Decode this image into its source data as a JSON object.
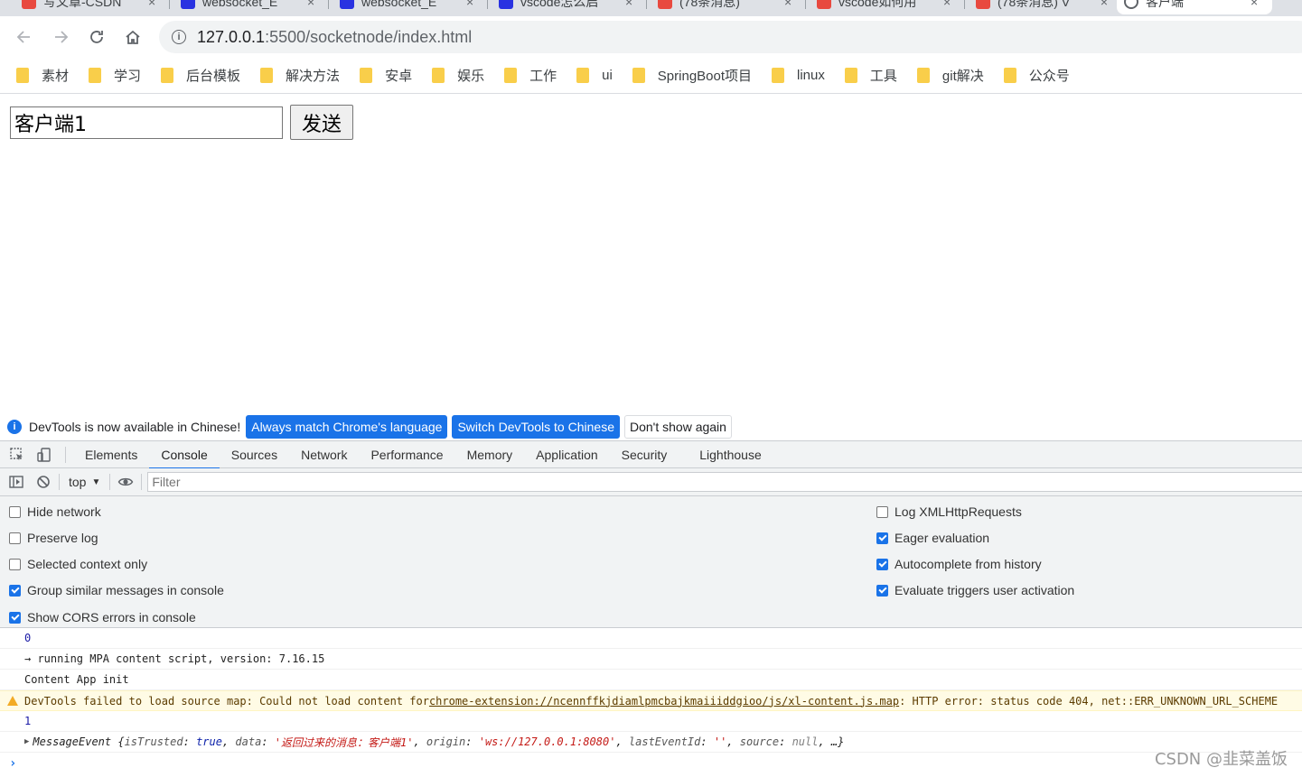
{
  "browser": {
    "tabs": [
      {
        "title": "写文章-CSDN",
        "color": "#e8493f"
      },
      {
        "title": "websocket_E",
        "color": "#2932e1"
      },
      {
        "title": "websocket_E",
        "color": "#2932e1"
      },
      {
        "title": "vscode怎么启",
        "color": "#2932e1"
      },
      {
        "title": "(78条消息)",
        "color": "#e8493f"
      },
      {
        "title": "vscode如何用",
        "color": "#e8493f"
      },
      {
        "title": "(78条消息) V",
        "color": "#e8493f"
      },
      {
        "title": "客户端",
        "color": "#5f6368"
      }
    ],
    "tab_close": "×",
    "url_host": "127.0.0.1",
    "url_path": ":5500/socketnode/index.html",
    "bookmarks": [
      "素材",
      "学习",
      "后台模板",
      "解决方法",
      "安卓",
      "娱乐",
      "工作",
      "ui",
      "SpringBoot项目",
      "linux",
      "工具",
      "git解决",
      "公众号"
    ]
  },
  "page": {
    "input_value": "客户端1",
    "send_label": "发送"
  },
  "devtools": {
    "infobar": {
      "text": "DevTools is now available in Chinese!",
      "btn_match": "Always match Chrome's language",
      "btn_switch": "Switch DevTools to Chinese",
      "btn_dismiss": "Don't show again"
    },
    "tabs": [
      "Elements",
      "Console",
      "Sources",
      "Network",
      "Performance",
      "Memory",
      "Application",
      "Security",
      "Lighthouse"
    ],
    "active_tab": "Console",
    "context": "top",
    "filter_placeholder": "Filter",
    "settings_left": [
      {
        "label": "Hide network",
        "checked": false
      },
      {
        "label": "Preserve log",
        "checked": false
      },
      {
        "label": "Selected context only",
        "checked": false
      },
      {
        "label": "Group similar messages in console",
        "checked": true
      },
      {
        "label": "Show CORS errors in console",
        "checked": true
      }
    ],
    "settings_right": [
      {
        "label": "Log XMLHttpRequests",
        "checked": false
      },
      {
        "label": "Eager evaluation",
        "checked": true
      },
      {
        "label": "Autocomplete from history",
        "checked": true
      },
      {
        "label": "Evaluate triggers user activation",
        "checked": true
      }
    ],
    "log": {
      "line1": "0",
      "line2": "→ running MPA content script, version: 7.16.15",
      "line3": "Content App init",
      "warn_prefix": "DevTools failed to load source map: Could not load content for ",
      "warn_link": "chrome-extension://ncennffkjdiamlpmcbajkmaiiiddgioo/js/xl-content.js.map",
      "warn_suffix": ": HTTP error: status code 404, net::ERR_UNKNOWN_URL_SCHEME",
      "line5": "1",
      "obj_name": "MessageEvent",
      "obj_istrusted_key": "isTrusted",
      "obj_istrusted_val": "true",
      "obj_data_key": "data",
      "obj_data_val": "'返回过来的消息：客户端1'",
      "obj_origin_key": "origin",
      "obj_origin_val": "'ws://127.0.0.1:8080'",
      "obj_lastid_key": "lastEventId",
      "obj_lastid_val": "''",
      "obj_source_key": "source",
      "obj_source_val": "null",
      "obj_more": "…}",
      "prompt": "›"
    }
  },
  "watermark": "CSDN @韭菜盖饭"
}
